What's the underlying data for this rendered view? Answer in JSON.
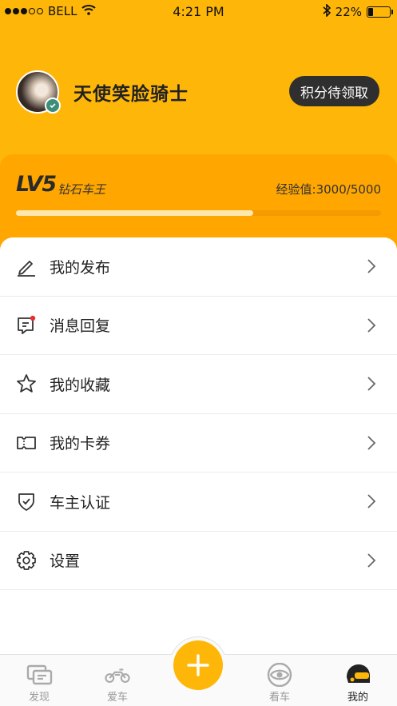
{
  "status_bar": {
    "carrier": "BELL",
    "time": "4:21 PM",
    "battery": "22%",
    "battery_level": 0.22
  },
  "profile": {
    "username": "天使笑脸骑士",
    "points_button": "积分待领取"
  },
  "level": {
    "code": "LV5",
    "name": "钻石车王",
    "exp_text": "经验值:3000/5000",
    "progress": 0.65
  },
  "menu": [
    {
      "label": "我的发布",
      "icon": "pen-icon"
    },
    {
      "label": "消息回复",
      "icon": "message-icon"
    },
    {
      "label": "我的收藏",
      "icon": "star-icon"
    },
    {
      "label": "我的卡券",
      "icon": "coupon-icon"
    },
    {
      "label": "车主认证",
      "icon": "shield-check-icon"
    },
    {
      "label": "设置",
      "icon": "gear-icon"
    }
  ],
  "tabbar": {
    "tabs": [
      {
        "label": "发现",
        "icon": "discover-icon"
      },
      {
        "label": "爱车",
        "icon": "motorcycle-icon"
      },
      {
        "label": "看车",
        "icon": "eye-icon"
      },
      {
        "label": "我的",
        "icon": "helmet-icon"
      }
    ],
    "add_icon": "plus-icon"
  },
  "colors": {
    "brand": "#FEB708",
    "level_card": "#FFA600",
    "notification_dot": "#E8312F"
  }
}
